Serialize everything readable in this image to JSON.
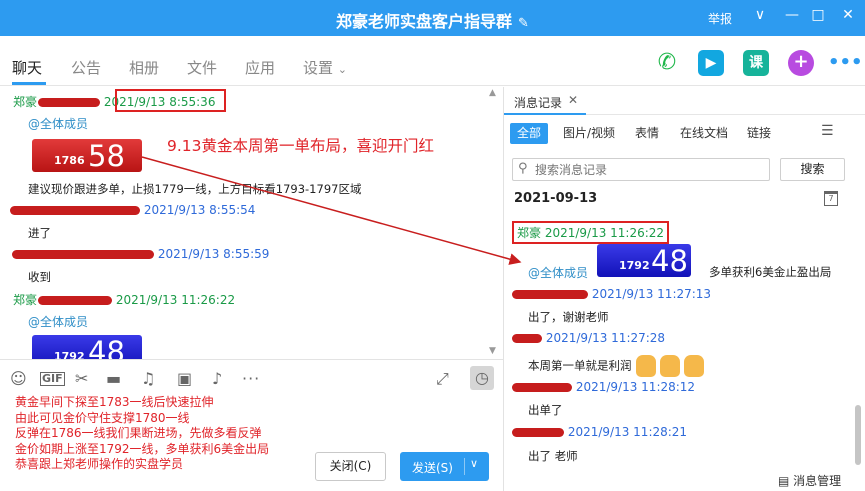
{
  "window": {
    "title": "郑豪老师实盘客户指导群",
    "report_label": "举报",
    "collapse_glyph": "∨",
    "minimize_glyph": "—",
    "maximize_glyph": "□",
    "close_glyph": "✕"
  },
  "nav": {
    "tabs": [
      "聊天",
      "公告",
      "相册",
      "文件",
      "应用",
      "设置"
    ],
    "active_tab": "聊天",
    "course_icon_label": "课",
    "colors": {
      "accent": "#2d9bf0",
      "phone": "#1fb74a",
      "video": "#12a7e0",
      "course": "#16b39a",
      "more": "#b84be0"
    }
  },
  "chat": {
    "annotation": "9.13黄金本周第一单布局，喜迎开门红",
    "messages": [
      {
        "sender": "郑豪",
        "time": "2021/9/13 8:55:36",
        "mention": "@全体成员",
        "card_small": "1786",
        "card_big": "58",
        "text": "建议现价跟进多单，止损1779一线，上方目标看1793-1797区域"
      },
      {
        "time": "2021/9/13 8:55:54",
        "text": "进了"
      },
      {
        "time": "2021/9/13 8:55:59",
        "text": "收到"
      },
      {
        "sender": "郑豪",
        "time": "2021/9/13 11:26:22",
        "mention": "@全体成员",
        "card_small": "1792",
        "card_big": "48"
      }
    ]
  },
  "input": {
    "draft_lines": [
      "黄金早间下探至1783一线后快速拉伸",
      "由此可见金价守住支撑1780一线",
      "反弹在1786一线我们果断进场，先做多看反弹",
      "金价如期上涨至1792一线，多单获利6美金出局",
      "恭喜跟上郑老师操作的实盘学员"
    ],
    "close_label": "关闭(C)",
    "send_label": "发送(S)",
    "send_arrow": "∨"
  },
  "history": {
    "tab_label": "消息记录",
    "tab_close": "✕",
    "filters": [
      "全部",
      "图片/视频",
      "表情",
      "在线文档",
      "链接"
    ],
    "active_filter": "全部",
    "search_placeholder": "搜索消息记录",
    "search_button": "搜索",
    "date": "2021-09-13",
    "highlight_header": "郑豪 2021/9/13 11:26:22",
    "mention": "@全体成员",
    "card_small": "1792",
    "card_big": "48",
    "card_caption": "多单获利6美金止盈出局",
    "entries": [
      {
        "time": "2021/9/13 11:27:13",
        "text": "出了，谢谢老师"
      },
      {
        "time": "2021/9/13 11:27:28",
        "text": "本周第一单就是利润"
      },
      {
        "time": "2021/9/13 11:28:12",
        "text": "出单了"
      },
      {
        "time": "2021/9/13 11:28:21",
        "text": "出了 老师"
      }
    ],
    "footer": "消息管理"
  }
}
